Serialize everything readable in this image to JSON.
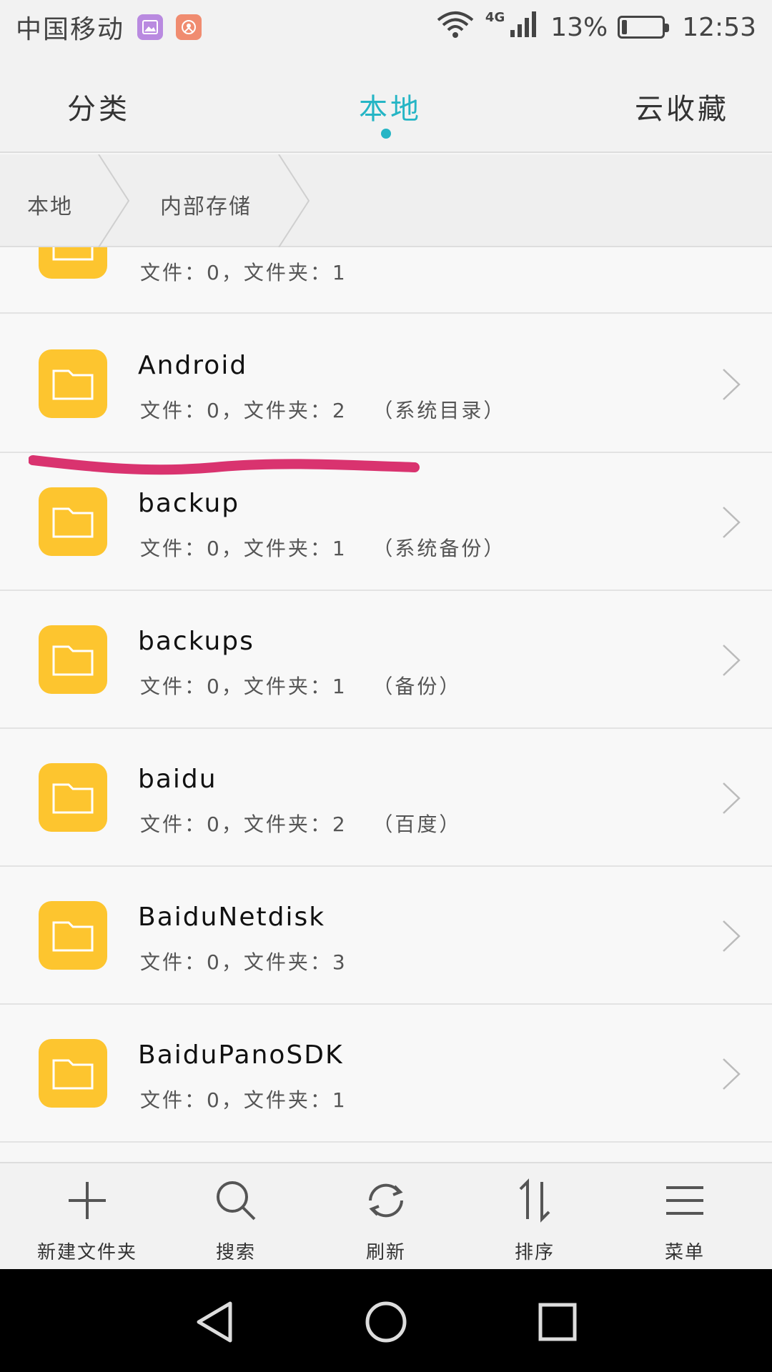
{
  "status_bar": {
    "carrier": "中国移动",
    "network": "4G",
    "battery": "13%",
    "battery_level": 0.13,
    "time": "12:53",
    "icons": [
      "gallery-notification-icon",
      "app-notification-icon",
      "wifi-icon",
      "signal-icon",
      "battery-icon"
    ]
  },
  "tabs": [
    {
      "label": "分类",
      "active": false
    },
    {
      "label": "本地",
      "active": true
    },
    {
      "label": "云收藏",
      "active": false
    }
  ],
  "accent_color": "#25b5c5",
  "folder_color": "#fdc52f",
  "annotation_color": "#d9336f",
  "breadcrumb": [
    "本地",
    "内部存储"
  ],
  "rows": [
    {
      "name": "",
      "meta": "文件：0，文件夹：1",
      "note": ""
    },
    {
      "name": "Android",
      "meta": "文件：0，文件夹：2",
      "note": "（系统目录）"
    },
    {
      "name": "backup",
      "meta": "文件：0，文件夹：1",
      "note": "（系统备份）"
    },
    {
      "name": "backups",
      "meta": "文件：0，文件夹：1",
      "note": "（备份）"
    },
    {
      "name": "baidu",
      "meta": "文件：0，文件夹：2",
      "note": "（百度）"
    },
    {
      "name": "BaiduNetdisk",
      "meta": "文件：0，文件夹：3",
      "note": ""
    },
    {
      "name": "BaiduPanoSDK",
      "meta": "文件：0，文件夹：1",
      "note": ""
    }
  ],
  "toolbar": [
    {
      "label": "新建文件夹",
      "icon": "plus-icon"
    },
    {
      "label": "搜索",
      "icon": "search-icon"
    },
    {
      "label": "刷新",
      "icon": "refresh-icon"
    },
    {
      "label": "排序",
      "icon": "sort-icon"
    },
    {
      "label": "菜单",
      "icon": "menu-icon"
    }
  ],
  "nav": [
    "back-icon",
    "home-icon",
    "recents-icon"
  ]
}
